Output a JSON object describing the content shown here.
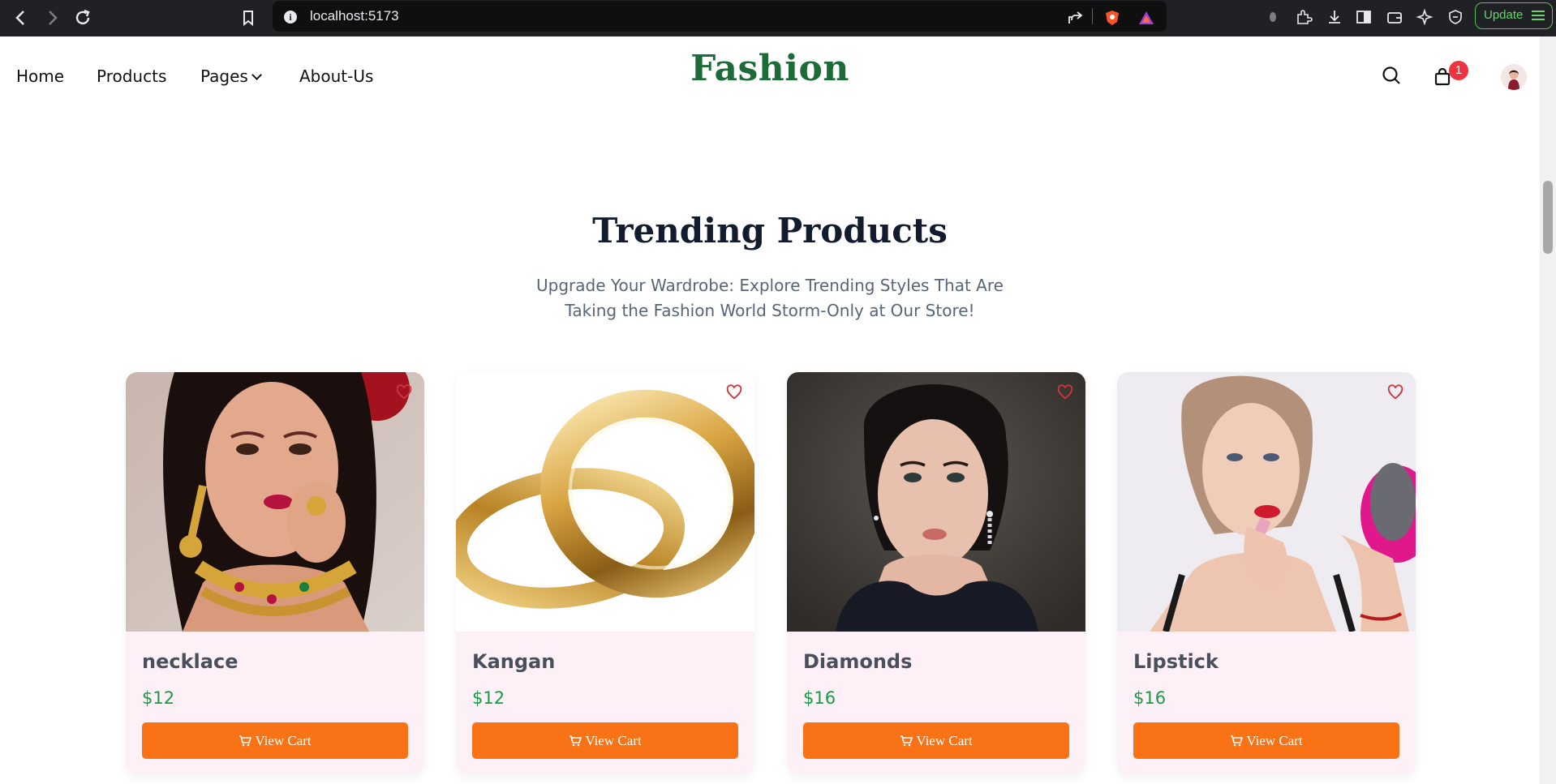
{
  "browser": {
    "url": "localhost:5173",
    "update_label": "Update"
  },
  "nav": {
    "links": [
      "Home",
      "Products",
      "Pages",
      "About-Us"
    ],
    "brand": "Fashion",
    "cart_count": "1"
  },
  "section": {
    "title": "Trending Products",
    "subtitle_line1": "Upgrade Your Wardrobe: Explore Trending Styles That Are",
    "subtitle_line2": "Taking the Fashion World Storm-Only at Our Store!"
  },
  "products": [
    {
      "name": "necklace",
      "price": "$12",
      "button": "View Cart"
    },
    {
      "name": "Kangan",
      "price": "$12",
      "button": "View Cart"
    },
    {
      "name": "Diamonds",
      "price": "$16",
      "button": "View Cart"
    },
    {
      "name": "Lipstick",
      "price": "$16",
      "button": "View Cart"
    }
  ],
  "colors": {
    "brand": "#1e6b3a",
    "button": "#f97316",
    "price": "#1b9a45",
    "badge": "#ef3340",
    "card_bg": "#fdf1f7",
    "heart": "#d0343e"
  },
  "icons": [
    "back-icon",
    "forward-icon",
    "reload-icon",
    "bookmark-icon",
    "info-icon",
    "share-icon",
    "search-icon",
    "bag-icon",
    "heart-icon",
    "cart-icon"
  ]
}
